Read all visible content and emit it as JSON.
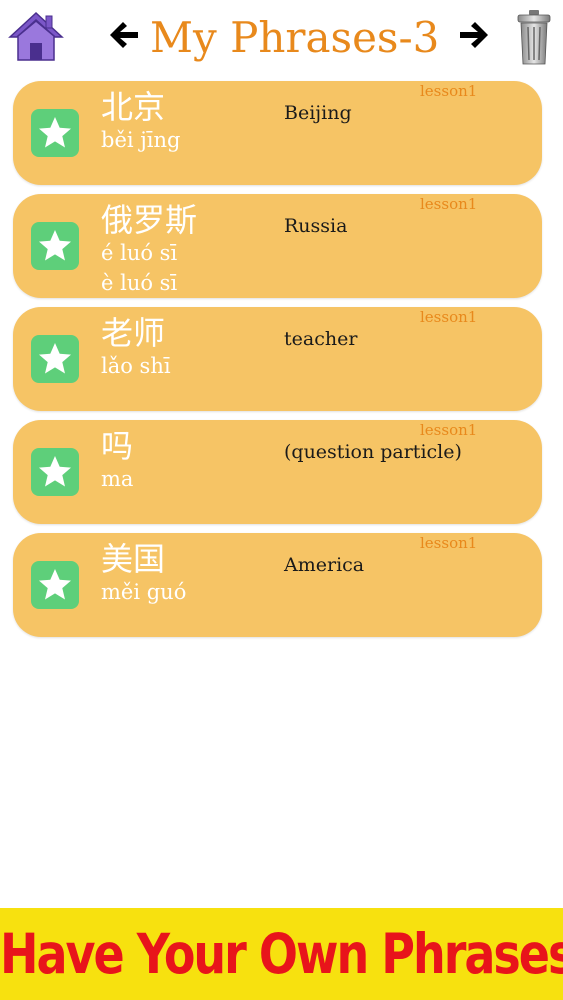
{
  "header": {
    "title": "My Phrases-3",
    "home_icon": "house-icon",
    "prev_icon": "arrow-left-icon",
    "next_icon": "arrow-right-icon",
    "trash_icon": "trash-icon"
  },
  "phrases": [
    {
      "hanzi": "北京",
      "pinyin": [
        "běi jīng"
      ],
      "meaning": "Beijing",
      "lesson": "lesson1"
    },
    {
      "hanzi": "俄罗斯",
      "pinyin": [
        "é luó sī",
        "è luó sī"
      ],
      "meaning": "Russia",
      "lesson": "lesson1"
    },
    {
      "hanzi": "老师",
      "pinyin": [
        "lǎo shī"
      ],
      "meaning": "teacher",
      "lesson": "lesson1"
    },
    {
      "hanzi": "吗",
      "pinyin": [
        "ma"
      ],
      "meaning": "(question particle)",
      "lesson": "lesson1"
    },
    {
      "hanzi": "美国",
      "pinyin": [
        "měi guó"
      ],
      "meaning": "America",
      "lesson": "lesson1"
    }
  ],
  "banner": {
    "text": "Have Your Own Phrases"
  },
  "colors": {
    "accent": "#e8891c",
    "card": "#f6c465",
    "star_box": "#5ecf7a",
    "banner_bg": "#f7e10f",
    "banner_text": "#e8141b"
  }
}
